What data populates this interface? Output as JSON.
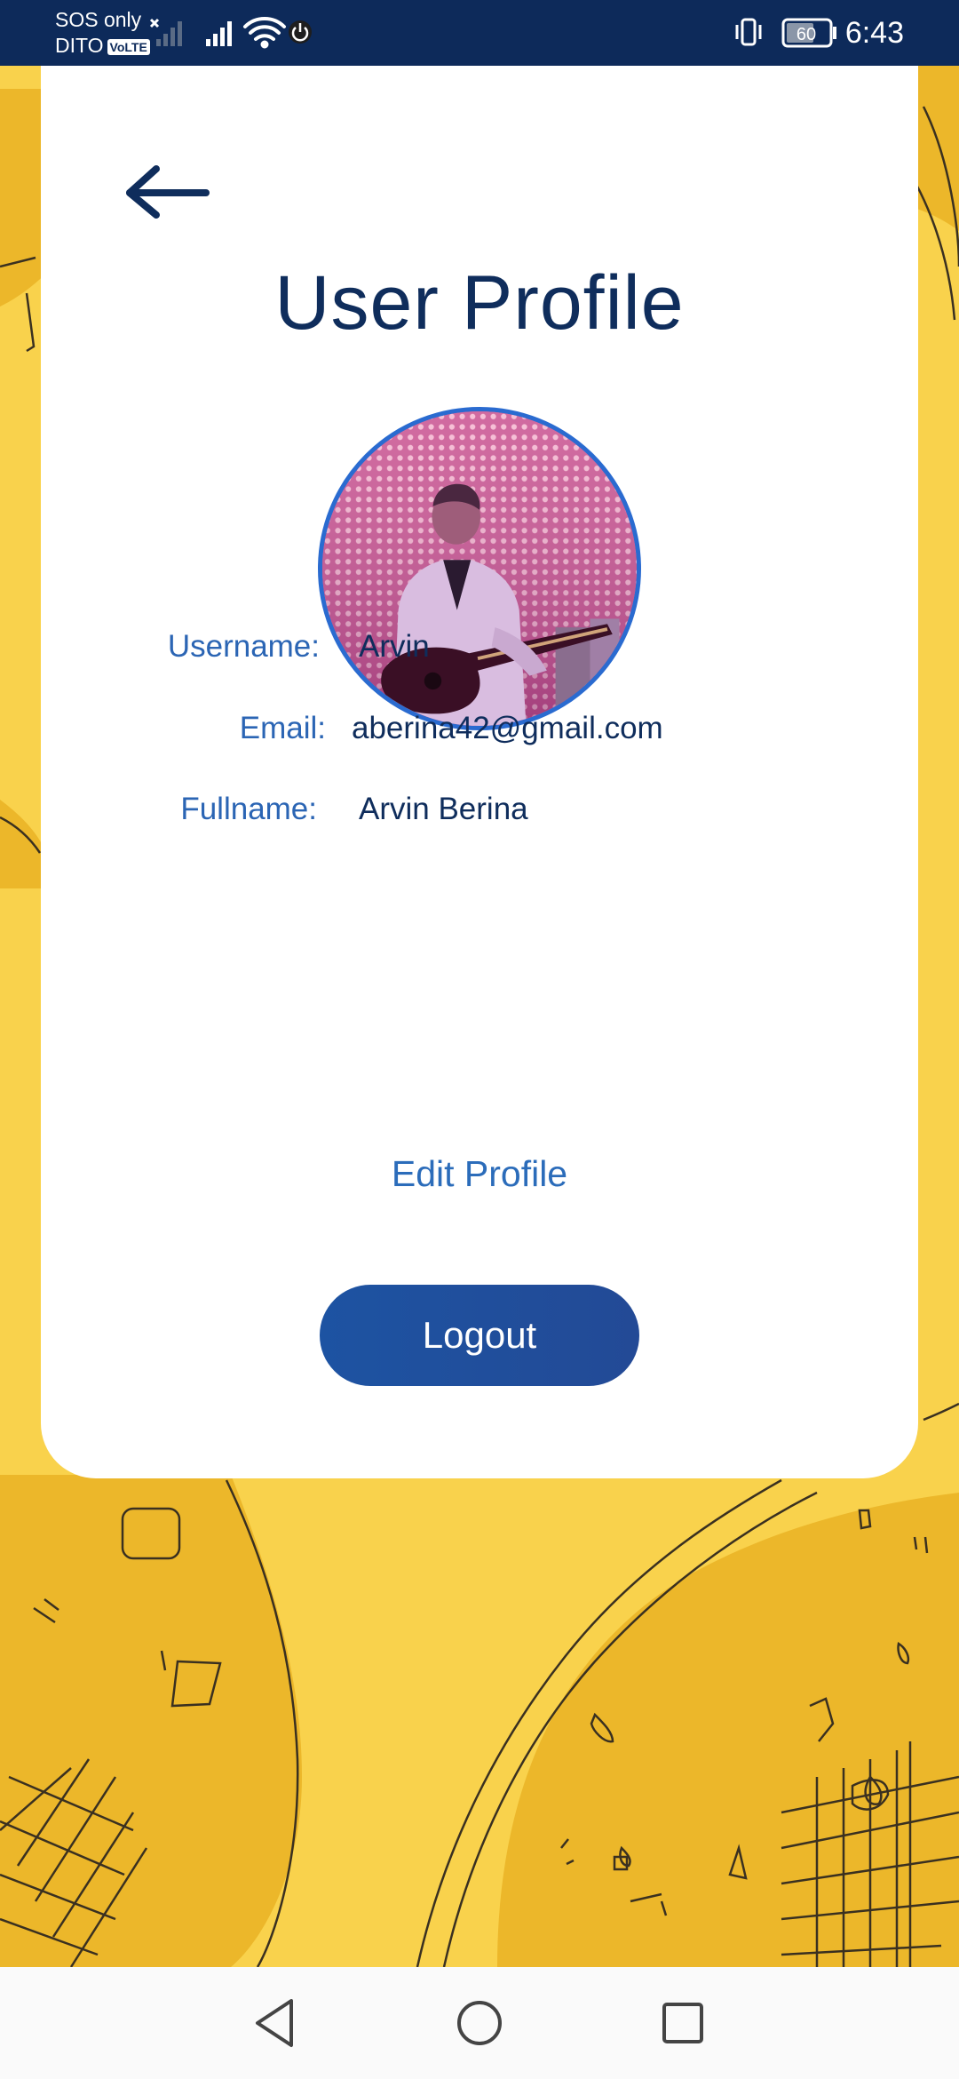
{
  "status_bar": {
    "carrier_line1": "SOS only",
    "carrier_line2": "DITO",
    "volte_badge": "VoLTE",
    "battery_level": "60",
    "time": "6:43",
    "icons": [
      "sim-x-icon",
      "no-signal-icon",
      "signal-icon",
      "wifi-icon",
      "power-saving-icon",
      "vibrate-icon",
      "battery-icon"
    ]
  },
  "page": {
    "back_icon": "arrow-left-icon",
    "title": "User Profile",
    "avatar_alt": "profile photo of user playing guitar"
  },
  "profile": {
    "username_label": "Username:",
    "username_value": "Arvin",
    "email_label": "Email:",
    "email_value": "aberina42@gmail.com",
    "fullname_label": "Fullname:",
    "fullname_value": "Arvin Berina"
  },
  "actions": {
    "edit_profile": "Edit Profile",
    "logout": "Logout"
  },
  "nav_bar": {
    "icons": [
      "back-triangle-icon",
      "home-circle-icon",
      "recents-square-icon"
    ]
  },
  "colors": {
    "status_bar_bg": "#0d2a5a",
    "background_yellow": "#f9d24c",
    "background_dark_yellow": "#ecb72a",
    "title_navy": "#0f2d5c",
    "label_blue": "#2b65b4",
    "button_blue": "#1d53a2",
    "avatar_ring": "#2a6bd0"
  }
}
